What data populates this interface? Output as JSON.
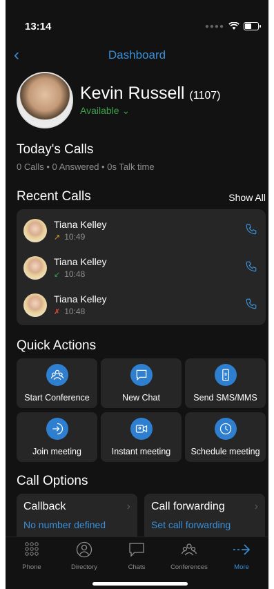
{
  "status": {
    "time": "13:14"
  },
  "nav": {
    "title": "Dashboard"
  },
  "profile": {
    "name": "Kevin Russell",
    "extension": "(1107)",
    "presence": "Available"
  },
  "todays_calls": {
    "title": "Today's Calls",
    "summary": "0 Calls • 0 Answered • 0s Talk time"
  },
  "recent_calls": {
    "title": "Recent Calls",
    "show_all": "Show All",
    "items": [
      {
        "name": "Tiana Kelley",
        "time": "10:49",
        "direction": "outgoing"
      },
      {
        "name": "Tiana Kelley",
        "time": "10:48",
        "direction": "incoming"
      },
      {
        "name": "Tiana Kelley",
        "time": "10:48",
        "direction": "missed"
      }
    ]
  },
  "quick_actions": {
    "title": "Quick Actions",
    "items": [
      {
        "label": "Start Conference",
        "icon": "conference-icon"
      },
      {
        "label": "New Chat",
        "icon": "chat-icon"
      },
      {
        "label": "Send SMS/MMS",
        "icon": "mobile-phone-icon"
      },
      {
        "label": "Join meeting",
        "icon": "join-arrow-icon"
      },
      {
        "label": "Instant meeting",
        "icon": "video-camera-icon"
      },
      {
        "label": "Schedule meeting",
        "icon": "clock-icon"
      }
    ]
  },
  "call_options": {
    "title": "Call Options",
    "items": [
      {
        "title": "Callback",
        "subtitle": "No number defined"
      },
      {
        "title": "Call forwarding",
        "subtitle": "Set call forwarding"
      }
    ]
  },
  "tabs": [
    {
      "label": "Phone",
      "icon": "dialpad-icon"
    },
    {
      "label": "Directory",
      "icon": "person-icon"
    },
    {
      "label": "Chats",
      "icon": "chat-bubble-icon"
    },
    {
      "label": "Conferences",
      "icon": "conference-icon"
    },
    {
      "label": "More",
      "icon": "arrow-right-icon",
      "active": true
    }
  ],
  "colors": {
    "accent": "#3a8fd8",
    "presence": "#3aa04a",
    "missed": "#e04a3a",
    "background": "#121212",
    "card": "#262626"
  }
}
